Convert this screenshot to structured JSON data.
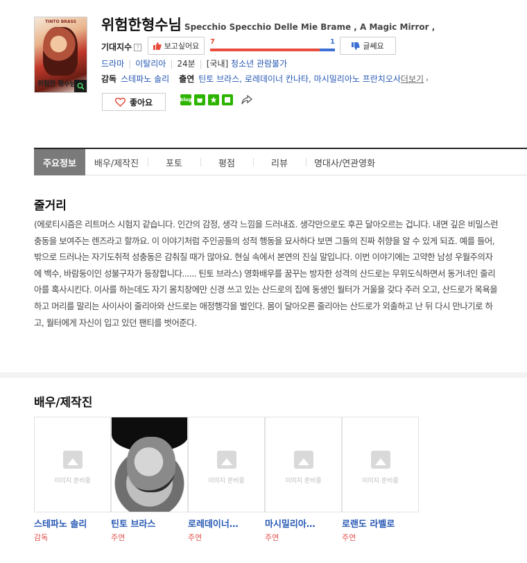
{
  "movie": {
    "title": "위험한형수님",
    "original_title": "Specchio Specchio Delle Mie Brame , A Magic Mirror ,",
    "poster": {
      "top_text": "TINTO BRASS",
      "title_text": "위험한 형수님"
    },
    "expectation": {
      "label": "기대지수",
      "help": "?",
      "want_label": "보고싶어요",
      "want_count": "7",
      "no_label": "글쎄요",
      "no_count": "1",
      "want_ratio": 0.875
    },
    "genre": "드라마",
    "country": "이탈리아",
    "runtime": "24분",
    "rating_prefix": "[국내]",
    "rating": "청소년 관람불가",
    "director_label": "감독",
    "director": "스테파노 솔리",
    "cast_label": "출연",
    "cast_names": "틴토 브라스, 로레데이너 칸나타, 마시밀리아노 프란치오사",
    "more_label": "더보기",
    "like_label": "좋아요"
  },
  "tabs": [
    "주요정보",
    "배우/제작진",
    "포토",
    "평점",
    "리뷰",
    "명대사/연관영화"
  ],
  "plot": {
    "heading": "줄거리",
    "text": "(에로티시즘은 리트머스 시험지 같습니다. 인간의 감정, 생각 느낌을 드러내죠. 생각만으로도 후끈 달아오르는 겁니다. 내면 깊은 비밀스런 충동을 보여주는 렌즈라고 할까요. 이 이야기처럼 주인공들의 성적 행동을 묘사하다 보면 그들의 진짜 취향을 알 수 있게 되죠. 예를 들어, 밖으로 드러나는 자기도취적 성충동은 감춰질 때가 많아요. 현실 속에서 본연의 진실 말입니다. 이번 이야기에는 고약한 남성 우월주의자에 백수, 바람둥이인 성불구자가 등장합니다...... 틴토 브라스) 영화배우를 꿈꾸는 방자한 성격의 산드로는 무위도식하면서 동거녀인 줄리아를 혹사시킨다. 이사를 하는데도 자기 몸치장에만 신경 쓰고 있는 산드로의 집에 동생인 월터가 거울을 갖다 주러 오고, 산드로가 목욕을 하고 머리를 말리는 사이사이 줄리아와 산드로는 애정행각을 벌인다. 몸이 달아오른 줄리아는 산드로가 외출하고 난 뒤 다시 만나기로 하고, 월터에게 자신이 입고 있던 팬티를 벗어준다."
  },
  "cast_section": {
    "heading": "배우/제작진",
    "no_image_text": "이미지 준비중",
    "people": [
      {
        "name": "스테파노 솔리",
        "role": "감독",
        "has_photo": false
      },
      {
        "name": "틴토 브라스",
        "role": "주연",
        "has_photo": true
      },
      {
        "name": "로레데이너…",
        "role": "주연",
        "has_photo": false
      },
      {
        "name": "마시밀리아…",
        "role": "주연",
        "has_photo": false
      },
      {
        "name": "로랜도 라벨로",
        "role": "주연",
        "has_photo": false
      }
    ]
  },
  "colors": {
    "accent_red": "#e74c3c",
    "accent_blue": "#3b6fd3",
    "link_blue": "#2557b3",
    "tab_active": "#7a7a7a"
  },
  "icons": [
    "zoom-icon",
    "thumbs-up-icon",
    "thumbs-down-icon",
    "heart-icon",
    "blog-share-icon",
    "cafe-share-icon",
    "star-share-icon",
    "memo-share-icon",
    "external-share-icon",
    "image-placeholder-icon"
  ]
}
